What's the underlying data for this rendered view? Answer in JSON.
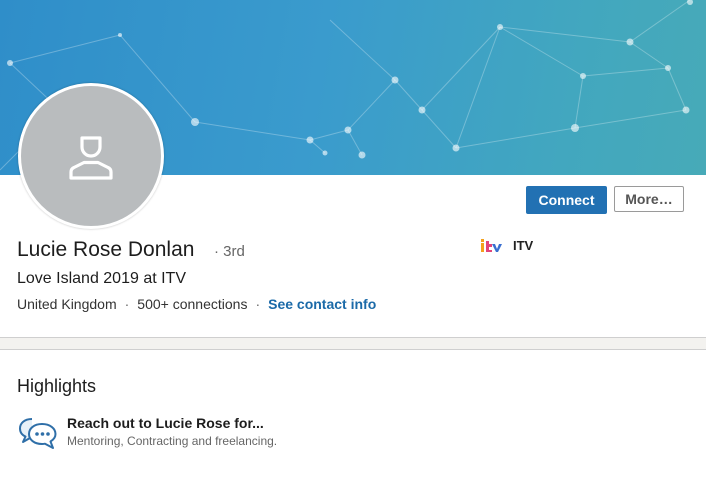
{
  "profile": {
    "name": "Lucie Rose Donlan",
    "degree": "· 3rd",
    "headline": "Love Island 2019 at ITV",
    "location": "United Kingdom",
    "connections": "500+ connections",
    "contact_link": "See contact info",
    "separator": "·"
  },
  "actions": {
    "connect_label": "Connect",
    "more_label": "More…"
  },
  "company": {
    "name": "ITV",
    "logo_icon": "itv-logo-icon"
  },
  "highlights": {
    "title": "Highlights",
    "item_title": "Reach out to Lucie Rose for...",
    "item_subtitle": "Mentoring, Contracting and freelancing.",
    "item_icon": "chat-bubbles-icon"
  },
  "colors": {
    "primary_button": "#2271b3",
    "link": "#1b6aa8",
    "banner_start": "#2f8ec9",
    "banner_end": "#47aab8",
    "avatar_bg": "#b9bcbe"
  }
}
